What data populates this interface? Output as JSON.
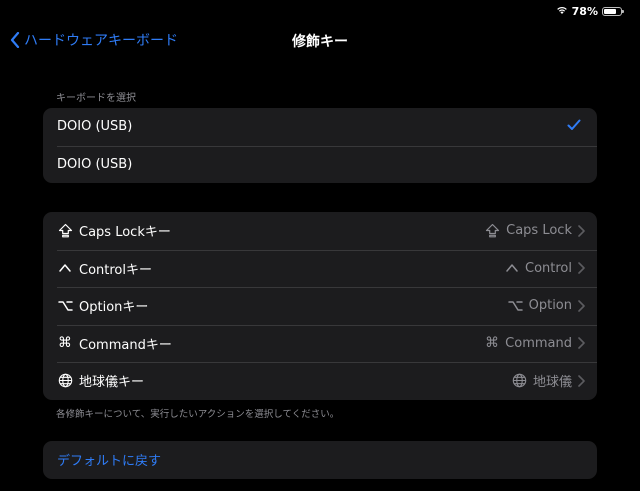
{
  "status": {
    "battery": "78%",
    "battery_level": 0.78
  },
  "nav": {
    "back_label": "ハードウェアキーボード",
    "title": "修飾キー"
  },
  "keyboard_section": {
    "header": "キーボードを選択",
    "items": [
      {
        "label": "DOIO (USB)",
        "selected": true
      },
      {
        "label": "DOIO (USB)",
        "selected": false
      }
    ]
  },
  "modifiers": {
    "items": [
      {
        "icon": "caps-lock-icon",
        "label": "Caps Lockキー",
        "value": "Caps Lock"
      },
      {
        "icon": "control-icon",
        "label": "Controlキー",
        "value": "Control"
      },
      {
        "icon": "option-icon",
        "label": "Optionキー",
        "value": "Option"
      },
      {
        "icon": "command-icon",
        "label": "Commandキー",
        "value": "Command"
      },
      {
        "icon": "globe-icon",
        "label": "地球儀キー",
        "value": "地球儀"
      }
    ],
    "footer": "各修飾キーについて、実行したいアクションを選択してください。"
  },
  "reset": {
    "label": "デフォルトに戻す"
  },
  "colors": {
    "accent": "#2f7cf6",
    "background": "#000000",
    "cell": "#1c1c1e",
    "secondary": "#8d8d93"
  }
}
